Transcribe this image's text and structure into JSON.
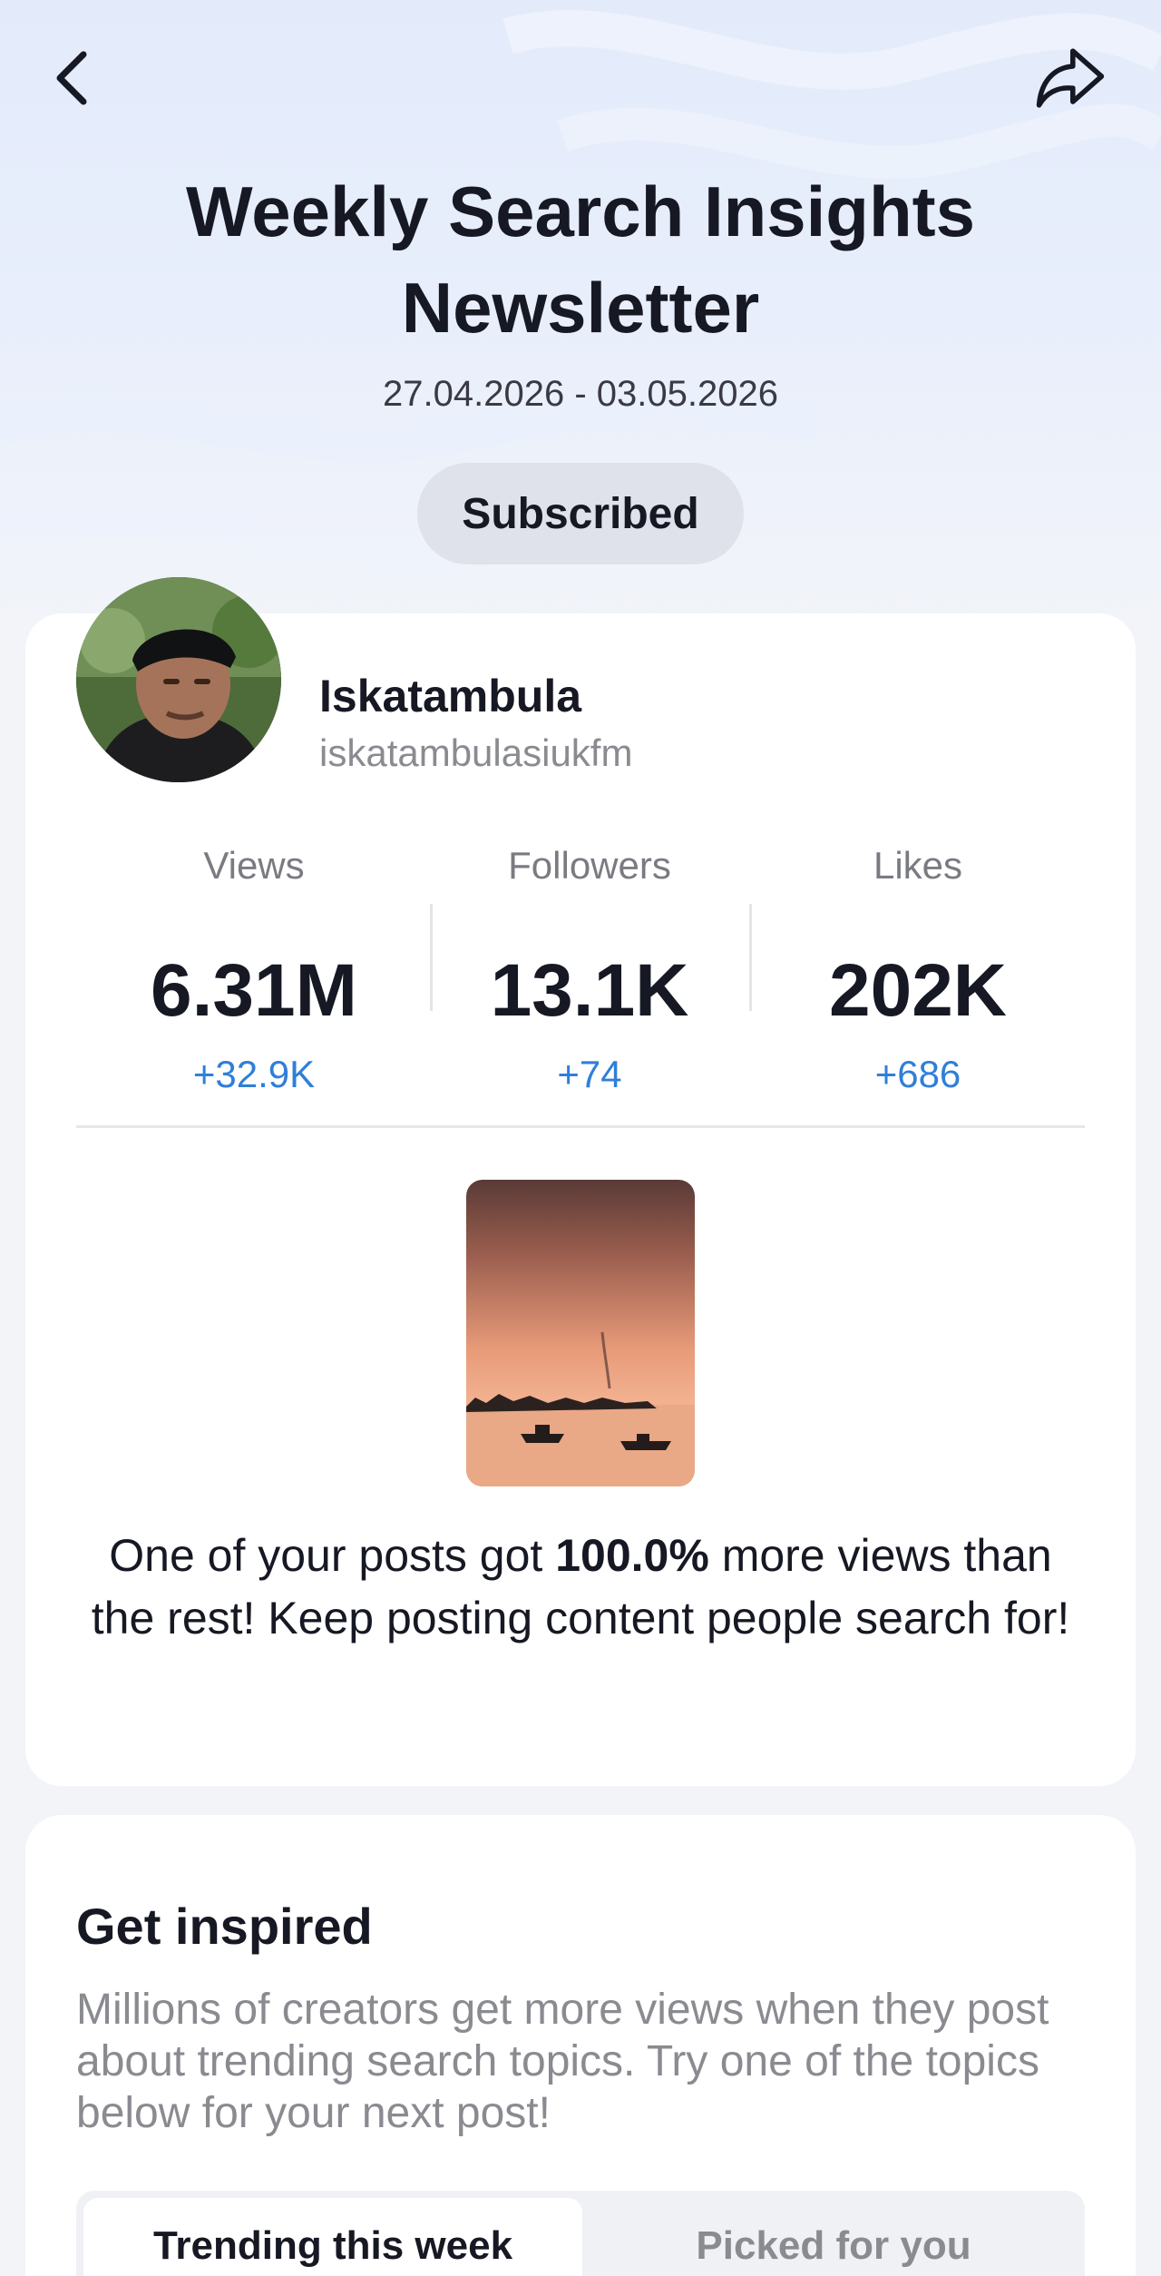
{
  "header": {
    "back_icon": "chevron-left-icon",
    "share_icon": "share-arrow-icon",
    "title_line1": "Weekly Search Insights",
    "title_line2": "Newsletter",
    "date_range": "27.04.2026 - 03.05.2026",
    "subscribe_label": "Subscribed"
  },
  "profile": {
    "name": "Iskatambula",
    "handle": "iskatambulasiukfm"
  },
  "stats": [
    {
      "label": "Views",
      "value": "6.31M",
      "delta": "+32.9K"
    },
    {
      "label": "Followers",
      "value": "13.1K",
      "delta": "+74"
    },
    {
      "label": "Likes",
      "value": "202K",
      "delta": "+686"
    }
  ],
  "post_highlight": {
    "prefix": "One of your posts got ",
    "percent": "100.0%",
    "suffix": " more views than the rest! Keep posting content people search for!"
  },
  "inspire": {
    "title": "Get inspired",
    "description": "Millions of creators get more views when they post about trending search topics. Try one of the topics below for your next post!",
    "tabs": [
      "Trending this week",
      "Picked for you"
    ],
    "active_tab": "Trending this week"
  },
  "colors": {
    "accent_delta": "#2f7fd9",
    "hero_bg": "#e3ebfb",
    "page_bg": "#f3f4f8"
  }
}
